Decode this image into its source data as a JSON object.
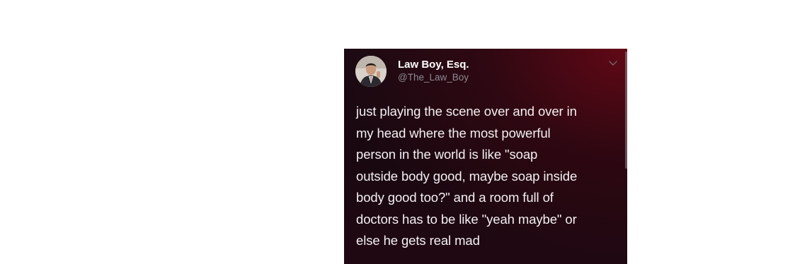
{
  "tweet": {
    "display_name": "Law Boy, Esq.",
    "handle": "@The_Law_Boy",
    "text": "just playing the scene over and over in\nmy head where the most powerful\nperson in the world is like \"soap\noutside body good, maybe soap inside\nbody good too?\" and a room full of\ndoctors has to be like \"yeah maybe\" or\nelse he gets real mad",
    "avatar_icon": "avatar-photo-icon",
    "menu_icon": "chevron-down-icon"
  },
  "colors": {
    "card_background": "#1c0a12",
    "card_glow": "#6e0816",
    "text": "#f2f0f2",
    "handle": "#8c8a92"
  }
}
